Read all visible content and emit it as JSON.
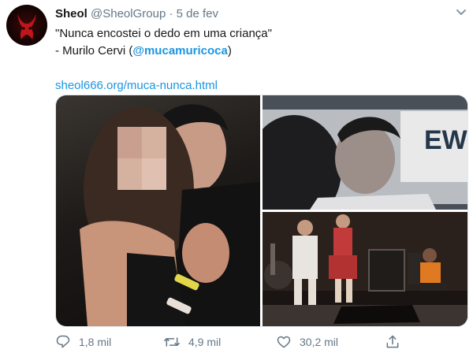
{
  "tweet": {
    "display_name": "Sheol",
    "handle": "@SheolGroup",
    "separator": "·",
    "date": "5 de fev",
    "quote": "\"Nunca encostei o dedo em uma criança\"",
    "attribution_prefix": "- Murilo Cervi (",
    "mention": "@mucamuricoca",
    "attribution_suffix": ")",
    "link": "sheol666.org/muca-nunca.html",
    "banner_text": "EWG"
  },
  "actions": {
    "replies": "1,8 mil",
    "retweets": "4,9 mil",
    "likes": "30,2 mil"
  },
  "icons": [
    "chevron-down-icon",
    "reply-icon",
    "retweet-icon",
    "like-icon",
    "share-icon"
  ],
  "colors": {
    "accent": "#1b95e0",
    "muted": "#657786",
    "text": "#14171a"
  }
}
